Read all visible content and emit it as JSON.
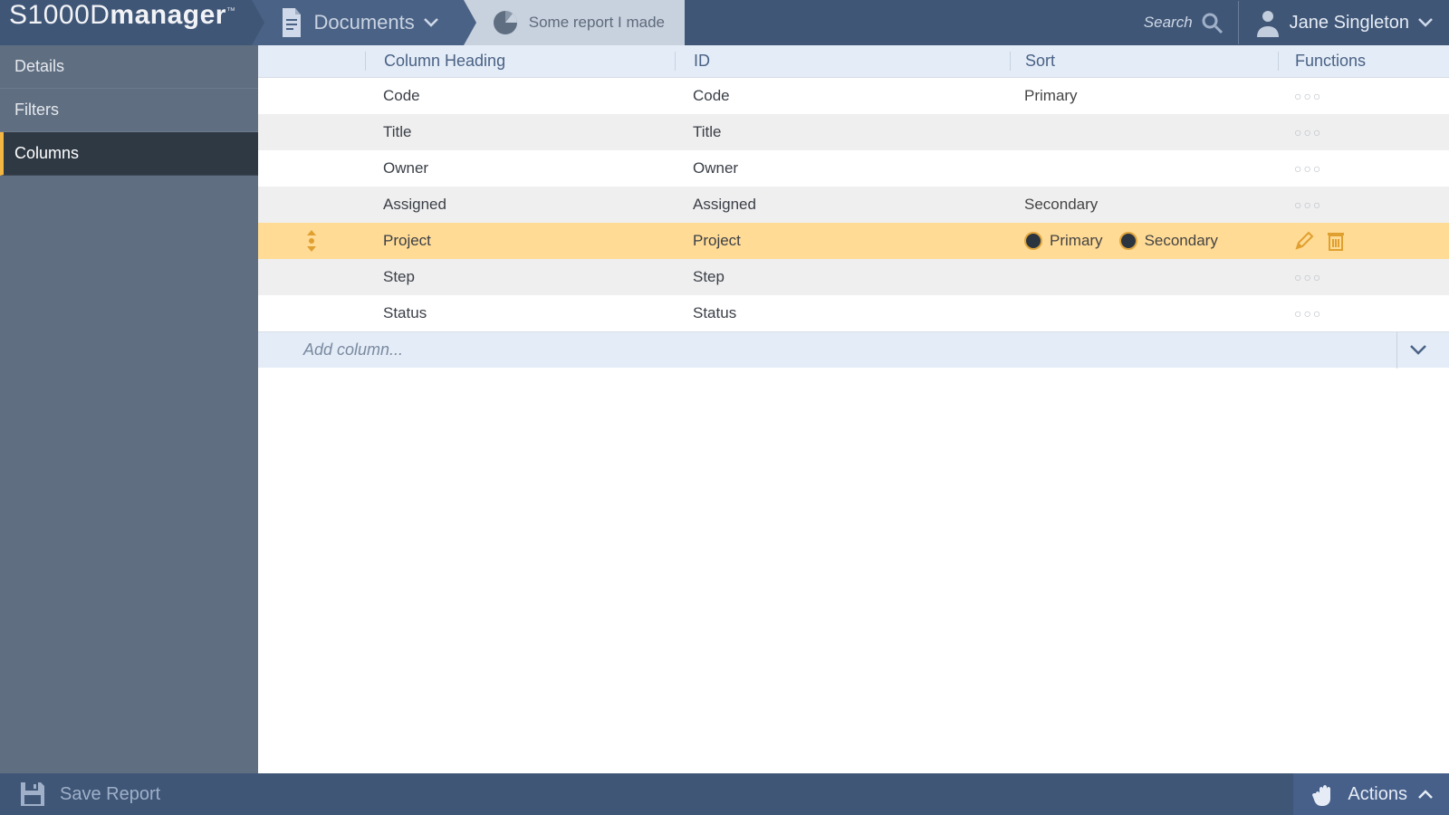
{
  "colors": {
    "accent": "#f4b642",
    "navy": "#3f5677"
  },
  "logo": {
    "prefix": "S1000D",
    "suffix": "manager",
    "tm": "™"
  },
  "nav": {
    "documents": "Documents",
    "report": "Some report I made"
  },
  "search": {
    "placeholder": "Search"
  },
  "user": {
    "name": "Jane Singleton"
  },
  "sidebar": {
    "items": [
      {
        "label": "Details"
      },
      {
        "label": "Filters"
      },
      {
        "label": "Columns"
      }
    ],
    "active_index": 2
  },
  "table": {
    "headers": {
      "heading": "Column Heading",
      "id": "ID",
      "sort": "Sort",
      "functions": "Functions"
    },
    "rows": [
      {
        "heading": "Code",
        "id": "Code",
        "sort": "Primary",
        "selected": false
      },
      {
        "heading": "Title",
        "id": "Title",
        "sort": "",
        "selected": false
      },
      {
        "heading": "Owner",
        "id": "Owner",
        "sort": "",
        "selected": false
      },
      {
        "heading": "Assigned",
        "id": "Assigned",
        "sort": "Secondary",
        "selected": false
      },
      {
        "heading": "Project",
        "id": "Project",
        "sort_radios": {
          "primary": "Primary",
          "secondary": "Secondary"
        },
        "selected": true
      },
      {
        "heading": "Step",
        "id": "Step",
        "sort": "",
        "selected": false
      },
      {
        "heading": "Status",
        "id": "Status",
        "sort": "",
        "selected": false
      }
    ],
    "add_placeholder": "Add column..."
  },
  "footer": {
    "save": "Save Report",
    "actions": "Actions"
  }
}
